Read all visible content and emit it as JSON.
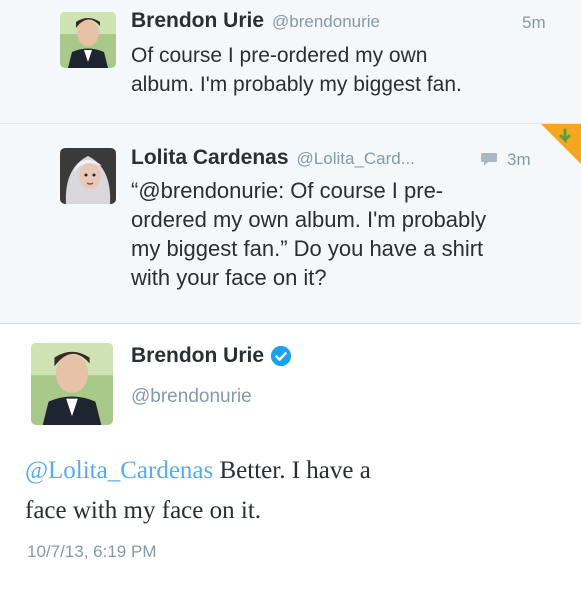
{
  "tweets": [
    {
      "name": "Brendon Urie",
      "handle": "@brendonurie",
      "time": "5m",
      "lines": [
        "Of course I pre-ordered my own",
        "album. I'm probably my biggest fan."
      ]
    },
    {
      "name": "Lolita Cardenas",
      "handle": "@Lolita_Card...",
      "time": "3m",
      "lines": [
        "“@brendonurie: Of course I pre-",
        "ordered my own album. I'm probably",
        "my biggest fan.” Do you have a shirt",
        "with your face on it?"
      ]
    }
  ],
  "detail": {
    "name": "Brendon Urie",
    "handle": "@brendonurie",
    "mention": "@Lolita_Cardenas",
    "text_line1": " Better. I have a",
    "text_line2": "face with my face on it.",
    "date": "10/7/13, 6:19 PM"
  },
  "colors": {
    "link": "#55acee",
    "muted": "#8899a6",
    "text": "#292f33",
    "verified": "#1da1f2",
    "flag_orange": "#f5a623",
    "flag_green": "#5aa03c"
  },
  "icons": [
    "reply-icon",
    "verified-icon",
    "corner-flag-icon"
  ]
}
